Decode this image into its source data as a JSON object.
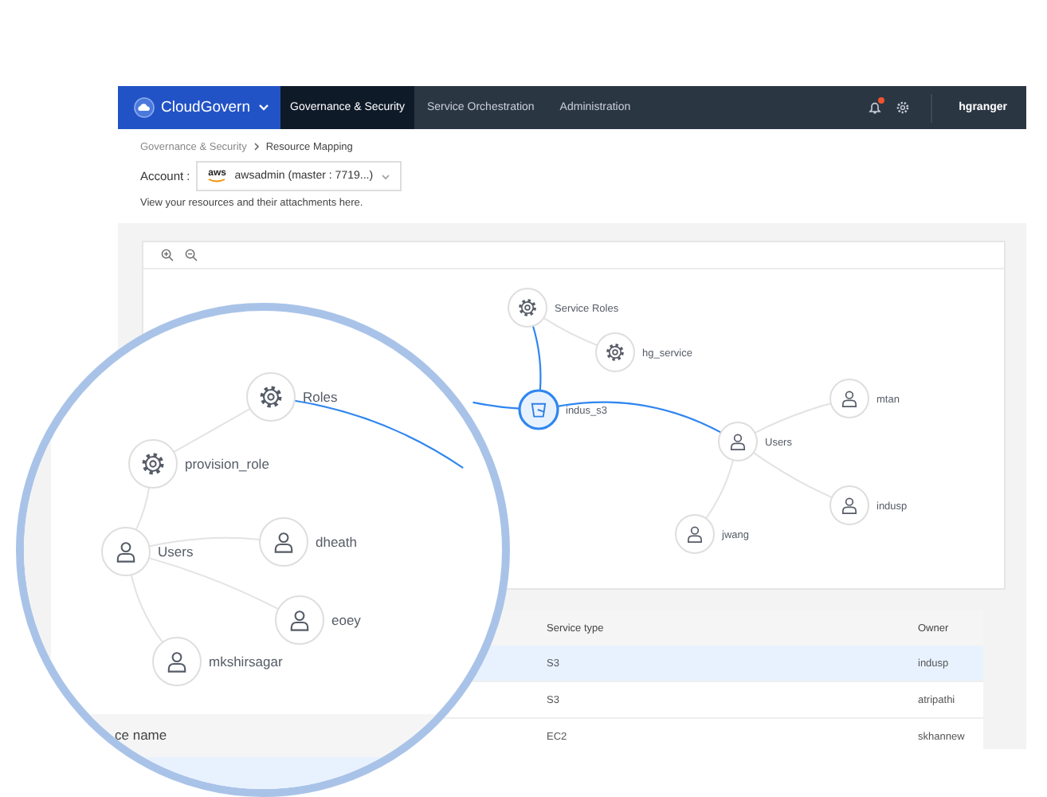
{
  "navbar": {
    "brand": "CloudGovern",
    "tabs": [
      {
        "label": "Governance & Security",
        "selected": true
      },
      {
        "label": "Service Orchestration",
        "selected": false
      },
      {
        "label": "Administration",
        "selected": false
      }
    ],
    "notification_badge": true,
    "user": "hgranger"
  },
  "breadcrumb": [
    "Governance & Security",
    "Resource Mapping"
  ],
  "account": {
    "label": "Account :",
    "logo": "aws",
    "value": "awsadmin (master : 7719...)"
  },
  "description": "View your resources and their attachments here.",
  "graph": {
    "nodes": [
      {
        "kind": "role",
        "label": "Service Roles",
        "selected": false
      },
      {
        "kind": "role",
        "label": "hg_service",
        "selected": false
      },
      {
        "kind": "bucket",
        "label": "indus_s3",
        "selected": true
      },
      {
        "kind": "user",
        "label": "Users",
        "selected": false
      },
      {
        "kind": "user",
        "label": "mtan",
        "selected": false
      },
      {
        "kind": "user",
        "label": "indusp",
        "selected": false
      },
      {
        "kind": "user",
        "label": "jwang",
        "selected": false
      }
    ]
  },
  "table": {
    "columns": [
      "Service type",
      "Owner"
    ],
    "rows": [
      {
        "cells": [
          "S3",
          "indusp"
        ],
        "selected": true
      },
      {
        "cells": [
          "S3",
          "atripathi"
        ],
        "selected": false
      },
      {
        "cells": [
          "EC2",
          "skhannew"
        ],
        "selected": false
      }
    ]
  },
  "magnifier": {
    "nodes": [
      {
        "kind": "role",
        "label": "Roles",
        "selected": false
      },
      {
        "kind": "role",
        "label": "provision_role",
        "selected": false
      },
      {
        "kind": "user",
        "label": "Users",
        "selected": false
      },
      {
        "kind": "user",
        "label": "dheath",
        "selected": false
      },
      {
        "kind": "user",
        "label": "eoey",
        "selected": false
      },
      {
        "kind": "user",
        "label": "mkshirsagar",
        "selected": false
      }
    ],
    "table_header": "ce name"
  }
}
